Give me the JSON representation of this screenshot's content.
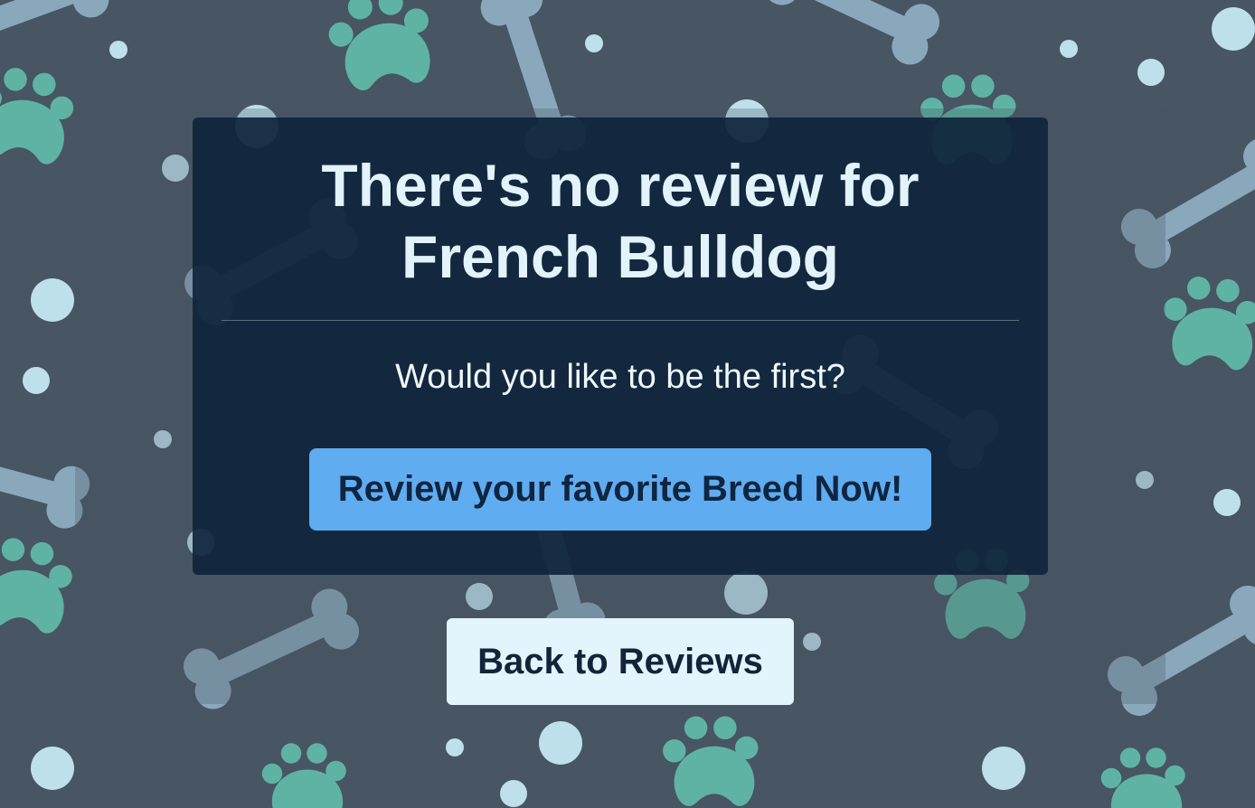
{
  "message": {
    "title_line1": "There's no review for",
    "title_line2": "French Bulldog",
    "subtitle": "Would you like to be the first?"
  },
  "actions": {
    "review_label": "Review your favorite Breed Now!",
    "back_label": "Back to Reviews"
  },
  "background": {
    "pattern_icons": [
      "paw-print-icon",
      "bone-icon",
      "dot"
    ]
  },
  "colors": {
    "background": "#485563",
    "paw": "#5fb3a4",
    "bone": "#89a8bc",
    "dot": "#bde0ea",
    "card": "#0f253c",
    "primary_button": "#5facf0",
    "secondary_button": "#e3f4fd"
  }
}
